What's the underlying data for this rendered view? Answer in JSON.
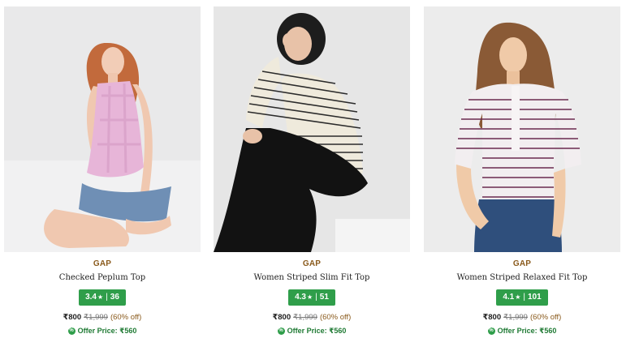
{
  "products": [
    {
      "brand": "GAP",
      "name": "Checked Peplum Top",
      "rating": "3.4",
      "rating_star": "★",
      "rating_sep": "|",
      "reviews": "36",
      "price": "₹800",
      "mrp": "₹1,999",
      "discount": "(60% off)",
      "offer_icon": "%",
      "offer_label": "Offer Price: ₹560"
    },
    {
      "brand": "GAP",
      "name": "Women Striped Slim Fit Top",
      "rating": "4.3",
      "rating_star": "★",
      "rating_sep": "|",
      "reviews": "51",
      "price": "₹800",
      "mrp": "₹1,999",
      "discount": "(60% off)",
      "offer_icon": "%",
      "offer_label": "Offer Price: ₹560"
    },
    {
      "brand": "GAP",
      "name": "Women Striped Relaxed Fit Top",
      "rating": "4.1",
      "rating_star": "★",
      "rating_sep": "|",
      "reviews": "101",
      "price": "₹800",
      "mrp": "₹1,999",
      "discount": "(60% off)",
      "offer_icon": "%",
      "offer_label": "Offer Price: ₹560"
    }
  ],
  "colors": {
    "brand": "#8a5a1c",
    "rating_badge": "#2f9e4a",
    "offer_text": "#1f7a34"
  }
}
